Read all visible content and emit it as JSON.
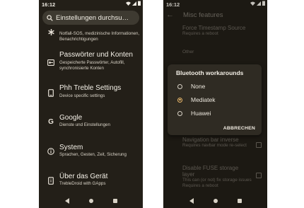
{
  "colors": {
    "phone_bg": "#231f18",
    "search_bg": "#3e3a31",
    "dialog_bg": "#2f2b23",
    "accent": "#e9b86a"
  },
  "left_phone": {
    "status_time": "16:12",
    "search": {
      "query": "Einstellungen durchsu…"
    },
    "items": [
      {
        "icon": "asterisk-icon",
        "title": "",
        "subtitle": "Notfall-SOS, medizinische Informationen, Benachrichtigungen"
      },
      {
        "icon": "password-key-icon",
        "title": "Passwörter und Konten",
        "subtitle": "Gespeicherte Passwörter, Autofill, synchronisierte Konten"
      },
      {
        "icon": "phone-settings-icon",
        "title": "Phh Treble Settings",
        "subtitle": "Device specific settings"
      },
      {
        "icon": "google-g-icon",
        "title": "Google",
        "subtitle": "Dienste und Einstellungen"
      },
      {
        "icon": "info-icon",
        "title": "System",
        "subtitle": "Sprachen, Gesten, Zeit, Sicherung"
      },
      {
        "icon": "phone-info-icon",
        "title": "Über das Gerät",
        "subtitle": "TrebleDroid with GApps"
      }
    ]
  },
  "right_phone": {
    "status_time": "16:12",
    "title": "Misc features",
    "prefs_top": [
      {
        "title": "Force Timestamp Source",
        "subtitle": "Requires a reboot"
      }
    ],
    "category": "Other",
    "prefs_bottom": [
      {
        "title": "Navigation bar inverse",
        "subtitle": "Requires navbar mode re-select"
      },
      {
        "title": "Disable FUSE storage layer",
        "subtitle": "This can (or not) fix storage issues Requires a reboot"
      }
    ],
    "dialog": {
      "title": "Bluetooth workarounds",
      "options": [
        {
          "label": "None",
          "selected": false
        },
        {
          "label": "Mediatek",
          "selected": true
        },
        {
          "label": "Huawei",
          "selected": false
        }
      ],
      "cancel": "ABBRECHEN"
    }
  }
}
